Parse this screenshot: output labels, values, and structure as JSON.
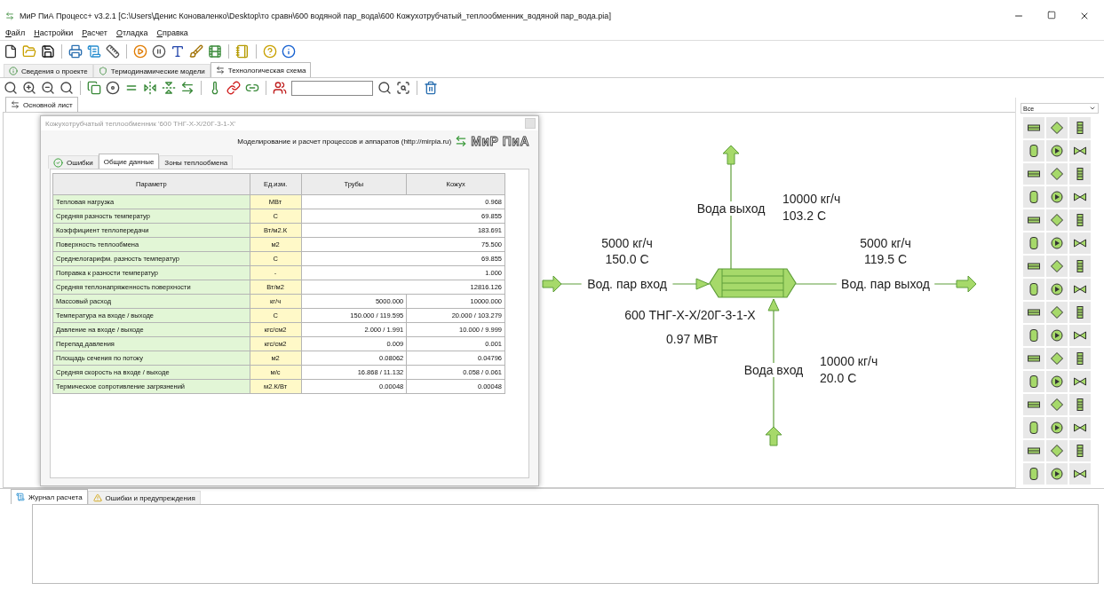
{
  "window": {
    "title": "МиР ПиА Процесс+ v3.2.1 [C:\\Users\\Денис Коноваленко\\Desktop\\то сравн\\600 водяной пар_вода\\600 Кожухотрубчатый_теплообменник_водяной пар_вода.pia]"
  },
  "menu": [
    "Файл",
    "Настройки",
    "Расчет",
    "Отладка",
    "Справка"
  ],
  "tabs": [
    {
      "label": "Сведения о проекте",
      "selected": false
    },
    {
      "label": "Термодинамические модели",
      "selected": false
    },
    {
      "label": "Технологическая схема",
      "selected": true
    }
  ],
  "sheet_tabs": [
    {
      "label": "Основной лист",
      "selected": true
    }
  ],
  "dialog": {
    "title": "Кожухотрубчатый теплообменник '600 ТНГ-Х-Х/20Г-3-1-Х'",
    "tagline": "Моделирование и расчет процессов и аппаратов (http://mirpia.ru)",
    "logo": "МиР ПиА",
    "tabs": [
      {
        "label": "Ошибки",
        "selected": false
      },
      {
        "label": "Общие данные",
        "selected": true
      },
      {
        "label": "Зоны теплообмена",
        "selected": false
      }
    ],
    "table": {
      "columns": [
        "Параметр",
        "Ед.изм.",
        "Трубы",
        "Кожух"
      ],
      "rows": [
        {
          "kind": "merged",
          "param": "Тепловая нагрузка",
          "unit": "МВт",
          "value": "0.968"
        },
        {
          "kind": "merged",
          "param": "Средняя разность температур",
          "unit": "С",
          "value": "69.855"
        },
        {
          "kind": "merged",
          "param": "Коэффициент теплопередачи",
          "unit": "Вт/м2.К",
          "value": "183.691"
        },
        {
          "kind": "merged",
          "param": "Поверхность теплообмена",
          "unit": "м2",
          "value": "75.500"
        },
        {
          "kind": "merged",
          "param": "Среднелогарифм. разность температур",
          "unit": "С",
          "value": "69.855"
        },
        {
          "kind": "merged",
          "param": "Поправка к разности температур",
          "unit": "-",
          "value": "1.000"
        },
        {
          "kind": "merged",
          "param": "Средняя теплонапряженность поверхности",
          "unit": "Вт/м2",
          "value": "12816.126"
        },
        {
          "kind": "split",
          "param": "Массовый расход",
          "unit": "кг/ч",
          "tubes": "5000.000",
          "shell": "10000.000"
        },
        {
          "kind": "split",
          "param": "Температура на входе / выходе",
          "unit": "С",
          "tubes": "150.000 / 119.595",
          "shell": "20.000 / 103.279"
        },
        {
          "kind": "split",
          "param": "Давление на входе / выходе",
          "unit": "кгс/см2",
          "tubes": "2.000 / 1.991",
          "shell": "10.000 / 9.999"
        },
        {
          "kind": "split",
          "param": "Перепад давления",
          "unit": "кгс/см2",
          "tubes": "0.009",
          "shell": "0.001"
        },
        {
          "kind": "split",
          "param": "Площадь сечения по потоку",
          "unit": "м2",
          "tubes": "0.08062",
          "shell": "0.04796"
        },
        {
          "kind": "split",
          "param": "Средняя скорость на входе / выходе",
          "unit": "м/с",
          "tubes": "16.868 / 11.132",
          "shell": "0.058 / 0.061"
        },
        {
          "kind": "split",
          "param": "Термическое сопротивление загрязнений",
          "unit": "м2.К/Вт",
          "tubes": "0.00048",
          "shell": "0.00048"
        }
      ]
    }
  },
  "diagram": {
    "equipment": {
      "name": "600 ТНГ-Х-Х/20Г-3-1-Х",
      "duty": "0.97 МВт"
    },
    "streams": [
      {
        "kind": "top",
        "name": "Вода выход",
        "flow": "10000 кг/ч",
        "temperature": "103.2 С"
      },
      {
        "kind": "left",
        "name": "Вод. пар вход",
        "flow": "5000 кг/ч",
        "temperature": "150.0 С"
      },
      {
        "kind": "right",
        "name": "Вод. пар выход",
        "flow": "5000 кг/ч",
        "temperature": "119.5 С"
      },
      {
        "kind": "bottom",
        "name": "Вода вход",
        "flow": "10000 кг/ч",
        "temperature": "20.0 С"
      }
    ]
  },
  "palette": {
    "filter": "Все"
  },
  "log_tabs": [
    {
      "label": "Журнал расчета",
      "selected": true
    },
    {
      "label": "Ошибки и предупреждения",
      "selected": false
    }
  ]
}
